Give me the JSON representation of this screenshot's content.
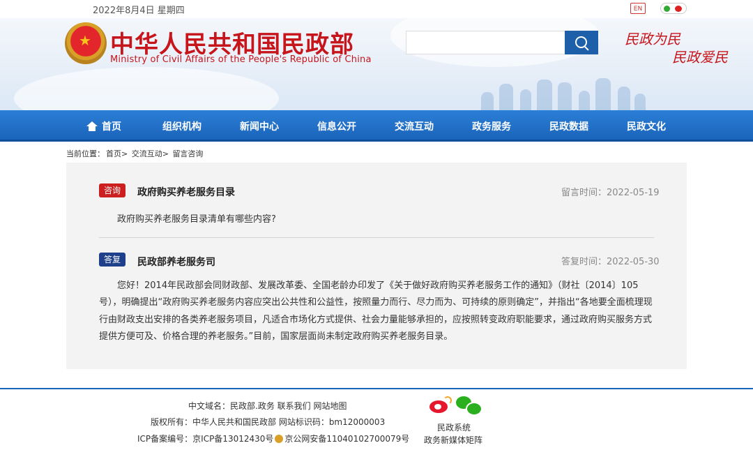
{
  "topbar": {
    "date": "2022年8月4日 星期四",
    "lang_icon_label": "EN"
  },
  "header": {
    "title_cn": "中华人民共和国民政部",
    "title_en": "Ministry of Civil Affairs of the People's Republic of China",
    "search_placeholder": "",
    "slogan_line1": "民政为民",
    "slogan_line2": "民政爱民"
  },
  "nav": {
    "items": [
      "首页",
      "组织机构",
      "新闻中心",
      "信息公开",
      "交流互动",
      "政务服务",
      "民政数据",
      "民政文化"
    ]
  },
  "breadcrumb": {
    "label": "当前位置：",
    "items": [
      "首页>",
      "交流互动>",
      "留言咨询"
    ]
  },
  "question": {
    "tag": "咨询",
    "title": "政府购买养老服务目录",
    "time": "留言时间：2022-05-19",
    "body": "政府购买养老服务目录清单有哪些内容?"
  },
  "answer": {
    "tag": "答复",
    "title": "民政部养老服务司",
    "time": "答复时间：2022-05-30",
    "body": "您好！2014年民政部会同财政部、发展改革委、全国老龄办印发了《关于做好政府购买养老服务工作的通知》（财社〔2014〕105号），明确提出“政府购买养老服务内容应突出公共性和公益性，按照量力而行、尽力而为、可持续的原则确定”，并指出“各地要全面梳理现行由财政支出安排的各类养老服务项目，凡适合市场化方式提供、社会力量能够承担的，应按照转变政府职能要求，通过政府购买服务方式提供方便可及、价格合理的养老服务。”目前，国家层面尚未制定政府购买养老服务目录。"
  },
  "footer": {
    "line1": "中文域名：民政部.政务    联系我们    网站地图",
    "line2": "版权所有：中华人民共和国民政部    网站标识码：bm12000003",
    "line3a": "ICP备案编号：京ICP备13012430号",
    "line3b": "京公网安备11040102700079号",
    "media_label1": "民政系统",
    "media_label2": "政务新媒体矩阵"
  }
}
